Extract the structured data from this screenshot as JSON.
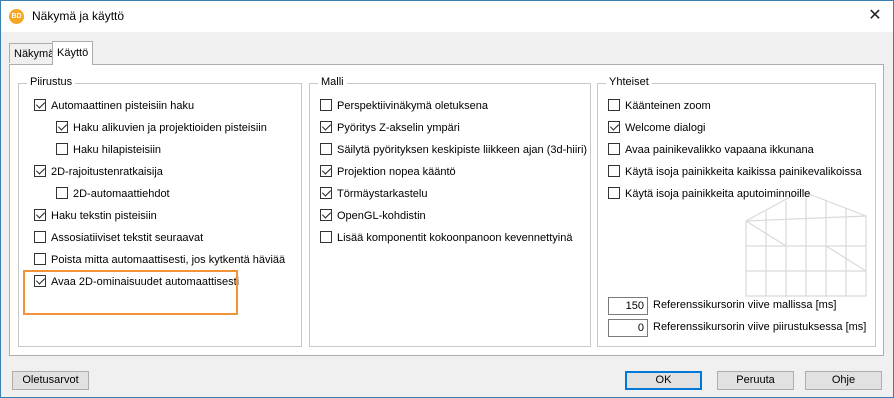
{
  "window": {
    "title": "Näkymä ja käyttö",
    "app_icon_text": "BD",
    "close_glyph": "✕"
  },
  "tabs": [
    {
      "label": "Näkymä"
    },
    {
      "label": "Käyttö"
    }
  ],
  "groups": {
    "piirustus": {
      "title": "Piirustus",
      "items": [
        {
          "label": "Automaattinen pisteisiin haku",
          "checked": true
        },
        {
          "label": "Haku alikuvien ja projektioiden pisteisiin",
          "checked": true
        },
        {
          "label": "Haku hilapisteisiin",
          "checked": false
        },
        {
          "label": "2D-rajoitustenratkaisija",
          "checked": true
        },
        {
          "label": "2D-automaattiehdot",
          "checked": false
        },
        {
          "label": "Haku tekstin pisteisiin",
          "checked": true
        },
        {
          "label": "Assosiatiiviset tekstit seuraavat",
          "checked": false
        },
        {
          "label": "Poista mitta automaattisesti, jos kytkentä häviää",
          "checked": false
        },
        {
          "label": "Avaa 2D-ominaisuudet automaattisesti",
          "checked": true
        }
      ]
    },
    "malli": {
      "title": "Malli",
      "items": [
        {
          "label": "Perspektiivinäkymä oletuksena",
          "checked": false
        },
        {
          "label": "Pyöritys Z-akselin ympäri",
          "checked": true
        },
        {
          "label": "Säilytä pyörityksen keskipiste liikkeen ajan (3d-hiiri)",
          "checked": false
        },
        {
          "label": "Projektion nopea kääntö",
          "checked": true
        },
        {
          "label": "Törmäystarkastelu",
          "checked": true
        },
        {
          "label": "OpenGL-kohdistin",
          "checked": true
        },
        {
          "label": "Lisää komponentit kokoonpanoon kevennettyinä",
          "checked": false
        }
      ]
    },
    "yhteiset": {
      "title": "Yhteiset",
      "items": [
        {
          "label": "Käänteinen zoom",
          "checked": false
        },
        {
          "label": "Welcome dialogi",
          "checked": true
        },
        {
          "label": "Avaa painikevalikko vapaana ikkunana",
          "checked": false
        },
        {
          "label": "Käytä isoja painikkeita kaikissa painikevalikoissa",
          "checked": false
        },
        {
          "label": "Käytä isoja painikkeita aputoiminnoille",
          "checked": false
        }
      ],
      "ref_model": {
        "value": "150",
        "label": "Referenssikursorin viive mallissa [ms]"
      },
      "ref_drawing": {
        "value": "0",
        "label": "Referenssikursorin viive piirustuksessa [ms]"
      }
    }
  },
  "buttons": {
    "defaults": "Oletusarvot",
    "ok": "OK",
    "cancel": "Peruuta",
    "help": "Ohje"
  },
  "colors": {
    "highlight": "#f39339",
    "window_border": "#3c7fb1",
    "primary_button_border": "#0078d7"
  }
}
